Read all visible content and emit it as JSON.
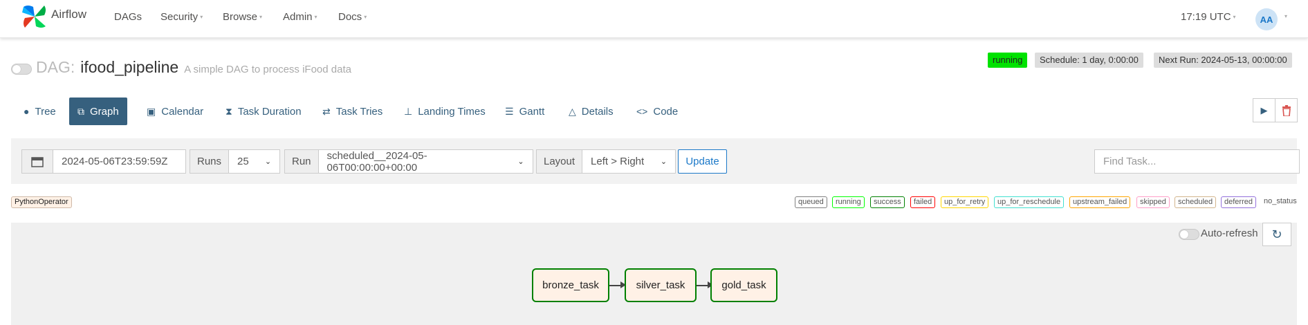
{
  "navbar": {
    "brand": "Airflow",
    "menu": [
      "DAGs",
      "Security",
      "Browse",
      "Admin",
      "Docs"
    ],
    "time": "17:19 UTC",
    "avatar": "AA"
  },
  "dag": {
    "label": "DAG:",
    "id": "ifood_pipeline",
    "description": "A simple DAG to process iFood data",
    "state": "running",
    "schedule": "Schedule: 1 day, 0:00:00",
    "next_run": "Next Run: 2024-05-13, 00:00:00"
  },
  "tabs": [
    "Tree",
    "Graph",
    "Calendar",
    "Task Duration",
    "Task Tries",
    "Landing Times",
    "Gantt",
    "Details",
    "Code"
  ],
  "active_tab": "Graph",
  "filters": {
    "base_date": "2024-05-06T23:59:59Z",
    "runs_label": "Runs",
    "runs_value": "25",
    "run_label": "Run",
    "run_value": "scheduled__2024-05-06T00:00:00+00:00",
    "layout_label": "Layout",
    "layout_value": "Left > Right",
    "update_label": "Update",
    "find_placeholder": "Find Task..."
  },
  "operator": "PythonOperator",
  "legend": [
    {
      "label": "queued",
      "color": "#808080"
    },
    {
      "label": "running",
      "color": "#00ff00"
    },
    {
      "label": "success",
      "color": "#008000"
    },
    {
      "label": "failed",
      "color": "#ff0000"
    },
    {
      "label": "up_for_retry",
      "color": "#ffd700"
    },
    {
      "label": "up_for_reschedule",
      "color": "#40e0d0"
    },
    {
      "label": "upstream_failed",
      "color": "#ffa500"
    },
    {
      "label": "skipped",
      "color": "#ff9ec7"
    },
    {
      "label": "scheduled",
      "color": "#d2b48c"
    },
    {
      "label": "deferred",
      "color": "#9370db"
    },
    {
      "label": "no_status",
      "color": ""
    }
  ],
  "graph": {
    "auto_refresh_label": "Auto-refresh",
    "nodes": [
      "bronze_task",
      "silver_task",
      "gold_task"
    ]
  },
  "colors": {
    "primary": "#36607e",
    "link": "#1b78c8",
    "success_border": "#008000",
    "node_fill": "#fff1e6",
    "running_pill": "#00e200"
  }
}
